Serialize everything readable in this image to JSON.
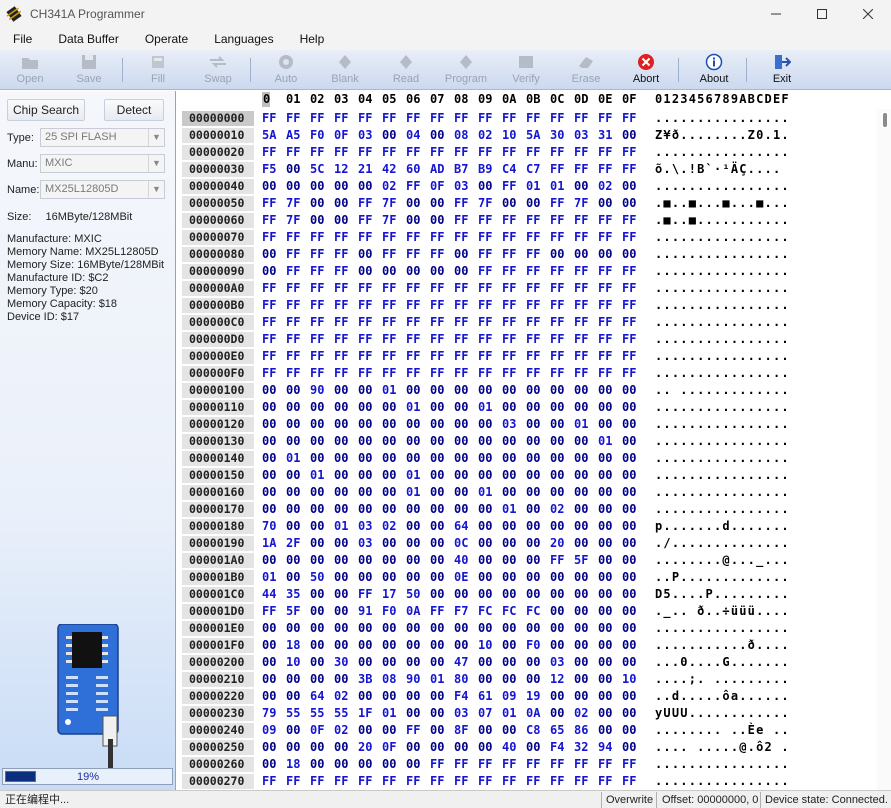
{
  "window": {
    "title": "CH341A Programmer",
    "controls": [
      "minimize",
      "maximize",
      "close"
    ]
  },
  "menu": [
    "File",
    "Data Buffer",
    "Operate",
    "Languages",
    "Help"
  ],
  "toolbar": [
    {
      "label": "Open",
      "icon": "folder-icon",
      "enabled": false
    },
    {
      "label": "Save",
      "icon": "floppy-icon",
      "enabled": false
    },
    {
      "label": "Fill",
      "icon": "fill-icon",
      "enabled": false
    },
    {
      "label": "Swap",
      "icon": "swap-icon",
      "enabled": false
    },
    {
      "label": "Auto",
      "icon": "auto-icon",
      "enabled": false
    },
    {
      "label": "Blank",
      "icon": "blank-icon",
      "enabled": false
    },
    {
      "label": "Read",
      "icon": "read-icon",
      "enabled": false
    },
    {
      "label": "Program",
      "icon": "program-icon",
      "enabled": false
    },
    {
      "label": "Verify",
      "icon": "verify-icon",
      "enabled": false
    },
    {
      "label": "Erase",
      "icon": "erase-icon",
      "enabled": false
    },
    {
      "label": "Abort",
      "icon": "abort-icon",
      "enabled": true
    },
    {
      "label": "About",
      "icon": "info-icon",
      "enabled": true
    },
    {
      "label": "Exit",
      "icon": "exit-icon",
      "enabled": true
    }
  ],
  "left_panel": {
    "chip_search_label": "Chip Search",
    "detect_label": "Detect",
    "type_label": "Type:",
    "type_value": "25 SPI FLASH",
    "manu_label": "Manu:",
    "manu_value": "MXIC",
    "name_label": "Name:",
    "name_value": "MX25L12805D",
    "size_label": "Size:",
    "size_value": "16MByte/128MBit",
    "info": [
      "Manufacture: MXIC",
      "Memory Name: MX25L12805D",
      "Memory Size: 16MByte/128MBit",
      "Manufacture ID: $C2",
      "Memory Type: $20",
      "Memory Capacity: $18",
      "Device ID: $17"
    ],
    "progress_percent": 19,
    "progress_text": "19%"
  },
  "hex": {
    "header_cursor": "0",
    "header_columns": [
      "0",
      "01",
      "02",
      "03",
      "04",
      "05",
      "06",
      "07",
      "08",
      "09",
      "0A",
      "0B",
      "0C",
      "0D",
      "0E",
      "0F"
    ],
    "header_ascii": "0123456789ABCDEF",
    "rows": [
      {
        "addr": "00000000",
        "bytes": "FF FF FF FF FF FF FF FF FF FF FF FF FF FF FF FF",
        "ascii": "................"
      },
      {
        "addr": "00000010",
        "bytes": "5A A5 F0 0F 03 00 04 00 08 02 10 5A 30 03 31 00",
        "ascii": "Z¥ð........Z0.1."
      },
      {
        "addr": "00000020",
        "bytes": "FF FF FF FF FF FF FF FF FF FF FF FF FF FF FF FF",
        "ascii": "................"
      },
      {
        "addr": "00000030",
        "bytes": "F5 00 5C 12 21 42 60 AD B7 B9 C4 C7 FF FF FF FF",
        "ascii": "õ.\\.!B`­·¹ÄÇ...."
      },
      {
        "addr": "00000040",
        "bytes": "00 00 00 00 00 02 FF 0F 03 00 FF 01 01 00 02 00",
        "ascii": "................"
      },
      {
        "addr": "00000050",
        "bytes": "FF 7F 00 00 FF 7F 00 00 FF 7F 00 00 FF 7F 00 00",
        "ascii": ".■..■...■...■..."
      },
      {
        "addr": "00000060",
        "bytes": "FF 7F 00 00 FF 7F 00 00 FF FF FF FF FF FF FF FF",
        "ascii": ".■..■..........."
      },
      {
        "addr": "00000070",
        "bytes": "FF FF FF FF FF FF FF FF FF FF FF FF FF FF FF FF",
        "ascii": "................"
      },
      {
        "addr": "00000080",
        "bytes": "00 FF FF FF 00 FF FF FF 00 FF FF FF 00 00 00 00",
        "ascii": "................"
      },
      {
        "addr": "00000090",
        "bytes": "00 FF FF FF 00 00 00 00 00 FF FF FF FF FF FF FF",
        "ascii": "................"
      },
      {
        "addr": "000000A0",
        "bytes": "FF FF FF FF FF FF FF FF FF FF FF FF FF FF FF FF",
        "ascii": "................"
      },
      {
        "addr": "000000B0",
        "bytes": "FF FF FF FF FF FF FF FF FF FF FF FF FF FF FF FF",
        "ascii": "................"
      },
      {
        "addr": "000000C0",
        "bytes": "FF FF FF FF FF FF FF FF FF FF FF FF FF FF FF FF",
        "ascii": "................"
      },
      {
        "addr": "000000D0",
        "bytes": "FF FF FF FF FF FF FF FF FF FF FF FF FF FF FF FF",
        "ascii": "................"
      },
      {
        "addr": "000000E0",
        "bytes": "FF FF FF FF FF FF FF FF FF FF FF FF FF FF FF FF",
        "ascii": "................"
      },
      {
        "addr": "000000F0",
        "bytes": "FF FF FF FF FF FF FF FF FF FF FF FF FF FF FF FF",
        "ascii": "................"
      },
      {
        "addr": "00000100",
        "bytes": "00 00 90 00 00 01 00 00 00 00 00 00 00 00 00 00",
        "ascii": ".. ............."
      },
      {
        "addr": "00000110",
        "bytes": "00 00 00 00 00 00 01 00 00 01 00 00 00 00 00 00",
        "ascii": "................"
      },
      {
        "addr": "00000120",
        "bytes": "00 00 00 00 00 00 00 00 00 00 03 00 00 01 00 00",
        "ascii": "................"
      },
      {
        "addr": "00000130",
        "bytes": "00 00 00 00 00 00 00 00 00 00 00 00 00 00 01 00",
        "ascii": "................"
      },
      {
        "addr": "00000140",
        "bytes": "00 01 00 00 00 00 00 00 00 00 00 00 00 00 00 00",
        "ascii": "................"
      },
      {
        "addr": "00000150",
        "bytes": "00 00 01 00 00 00 01 00 00 00 00 00 00 00 00 00",
        "ascii": "................"
      },
      {
        "addr": "00000160",
        "bytes": "00 00 00 00 00 00 01 00 00 01 00 00 00 00 00 00",
        "ascii": "................"
      },
      {
        "addr": "00000170",
        "bytes": "00 00 00 00 00 00 00 00 00 00 01 00 02 00 00 00",
        "ascii": "................"
      },
      {
        "addr": "00000180",
        "bytes": "70 00 00 01 03 02 00 00 64 00 00 00 00 00 00 00",
        "ascii": "p.......d......."
      },
      {
        "addr": "00000190",
        "bytes": "1A 2F 00 00 03 00 00 00 0C 00 00 00 20 00 00 00",
        "ascii": "./.............."
      },
      {
        "addr": "000001A0",
        "bytes": "00 00 00 00 00 00 00 00 40 00 00 00 FF 5F 00 00",
        "ascii": "........@..._..."
      },
      {
        "addr": "000001B0",
        "bytes": "01 00 50 00 00 00 00 00 0E 00 00 00 00 00 00 00",
        "ascii": "..P............."
      },
      {
        "addr": "000001C0",
        "bytes": "44 35 00 00 FF 17 50 00 00 00 00 00 00 00 00 00",
        "ascii": "D5....P........."
      },
      {
        "addr": "000001D0",
        "bytes": "FF 5F 00 00 91 F0 0A FF F7 FC FC FC 00 00 00 00",
        "ascii": "._.. ð..÷üüü...."
      },
      {
        "addr": "000001E0",
        "bytes": "00 00 00 00 00 00 00 00 00 00 00 00 00 00 00 00",
        "ascii": "................"
      },
      {
        "addr": "000001F0",
        "bytes": "00 18 00 00 00 00 00 00 00 10 00 F0 00 00 00 00",
        "ascii": "...........ð...."
      },
      {
        "addr": "00000200",
        "bytes": "00 10 00 30 00 00 00 00 47 00 00 00 03 00 00 00",
        "ascii": "...0....G......."
      },
      {
        "addr": "00000210",
        "bytes": "00 00 00 00 3B 08 90 01 80 00 00 00 12 00 00 10",
        "ascii": "....;. ........."
      },
      {
        "addr": "00000220",
        "bytes": "00 00 64 02 00 00 00 00 F4 61 09 19 00 00 00 00",
        "ascii": "..d.....ôa......"
      },
      {
        "addr": "00000230",
        "bytes": "79 55 55 55 1F 01 00 00 03 07 01 0A 00 02 00 00",
        "ascii": "yUUU............"
      },
      {
        "addr": "00000240",
        "bytes": "09 00 0F 02 00 00 FF 00 8F 00 00 C8 65 86 00 00",
        "ascii": "........ ..Èe .."
      },
      {
        "addr": "00000250",
        "bytes": "00 00 00 00 20 0F 00 00 00 00 40 00 F4 32 94 00",
        "ascii": ".... .....@.ô2 ."
      },
      {
        "addr": "00000260",
        "bytes": "00 18 00 00 00 00 00 FF FF FF FF FF FF FF FF FF",
        "ascii": "................"
      },
      {
        "addr": "00000270",
        "bytes": "FF FF FF FF FF FF FF FF FF FF FF FF FF FF FF FF",
        "ascii": "................"
      }
    ]
  },
  "statusbar": {
    "left": "正在编程中...",
    "mode": "Overwrite",
    "offset": "Offset: 00000000, 0",
    "device_state": "Device state: Connected."
  }
}
